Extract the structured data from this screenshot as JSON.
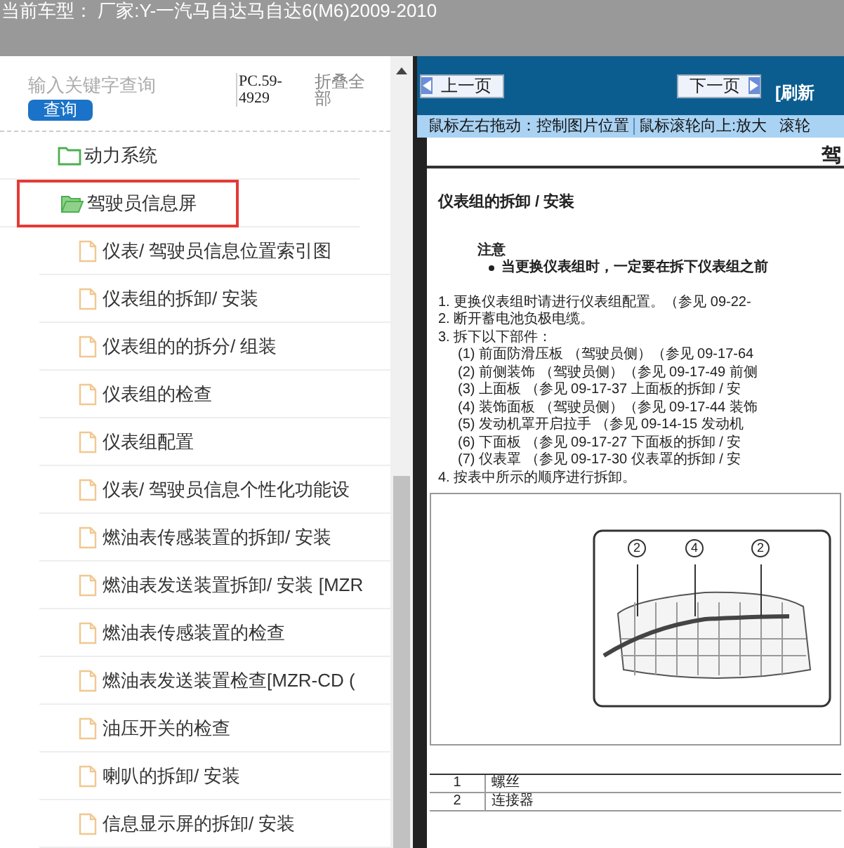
{
  "title_bar": {
    "text": "当前车型： 厂家:Y-一汽马自达马自达6(M6)2009-2010"
  },
  "sidebar": {
    "search": {
      "placeholder": "输入关键字查询"
    },
    "search_button": "查询",
    "code": "PC.59-4929",
    "collapse_all": "折叠全部",
    "tree": [
      {
        "label": "动力系统",
        "expanded": false,
        "selected": false
      },
      {
        "label": "驾驶员信息屏",
        "expanded": true,
        "selected": true,
        "children": [
          {
            "label": "仪表/ 驾驶员信息位置索引图",
            "selected": false
          },
          {
            "label": "仪表组的拆卸/ 安装",
            "selected": false
          },
          {
            "label": "仪表组的的拆分/ 组装",
            "selected": false
          },
          {
            "label": "仪表组的检查",
            "selected": false
          },
          {
            "label": "仪表组配置",
            "selected": false
          },
          {
            "label": "仪表/ 驾驶员信息个性化功能设",
            "selected": false
          },
          {
            "label": "燃油表传感装置的拆卸/ 安装",
            "selected": false
          },
          {
            "label": "燃油表发送装置拆卸/ 安装 [MZR",
            "selected": false
          },
          {
            "label": "燃油表传感装置的检查",
            "selected": false
          },
          {
            "label": "燃油表发送装置检查[MZR-CD (",
            "selected": false
          },
          {
            "label": "油压开关的检查",
            "selected": false
          },
          {
            "label": "喇叭的拆卸/ 安装",
            "selected": false
          },
          {
            "label": "信息显示屏的拆卸/ 安装",
            "selected": false
          }
        ]
      }
    ]
  },
  "viewer": {
    "prev_button": "上一页",
    "next_button": "下一页",
    "refresh_link": "[刷新",
    "hints": [
      "鼠标左右拖动：控制图片位置",
      "鼠标滚轮向上:放大",
      "滚轮"
    ],
    "document": {
      "header": "驾",
      "heading": "仪表组的拆卸 / 安装",
      "note_title": "注意",
      "note_bullet": "当更换仪表组时，一定要在拆下仪表组之前",
      "steps": [
        {
          "text": "1. 更换仪表组时请进行仪表组配置。（参见 09-22-"
        },
        {
          "text": "2. 断开蓄电池负极电缆。"
        },
        {
          "text": "3. 拆下以下部件：",
          "children": [
            "(1) 前面防滑压板 （驾驶员侧）（参见 09-17-64",
            "(2) 前侧装饰 （驾驶员侧）（参见 09-17-49 前侧",
            "(3) 上面板 （参见 09-17-37 上面板的拆卸 / 安",
            "(4) 装饰面板 （驾驶员侧）（参见 09-17-44 装饰",
            "(5) 发动机罩开启拉手 （参见 09-14-15 发动机",
            "(6) 下面板 （参见 09-17-27 下面板的拆卸 / 安",
            "(7) 仪表罩 （参见 09-17-30 仪表罩的拆卸 / 安"
          ]
        },
        {
          "text": "4. 按表中所示的顺序进行拆卸。"
        }
      ],
      "callouts": [
        "2",
        "4",
        "2"
      ],
      "parts": [
        {
          "no": "1",
          "name": "螺丝"
        },
        {
          "no": "2",
          "name": "连接器"
        }
      ]
    }
  }
}
